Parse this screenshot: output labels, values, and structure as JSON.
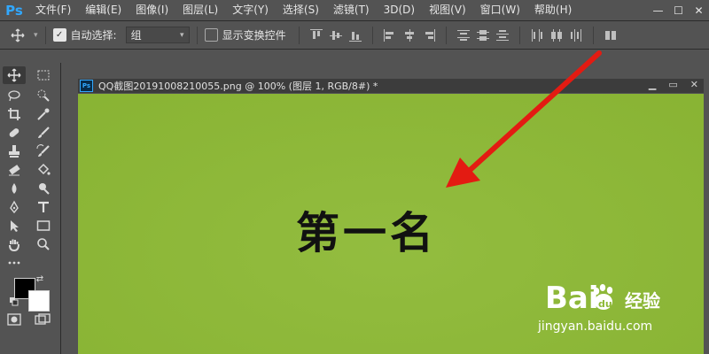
{
  "app": {
    "logo": "Ps"
  },
  "menu": {
    "items": [
      "文件(F)",
      "编辑(E)",
      "图像(I)",
      "图层(L)",
      "文字(Y)",
      "选择(S)",
      "滤镜(T)",
      "3D(D)",
      "视图(V)",
      "窗口(W)",
      "帮助(H)"
    ]
  },
  "window_controls": [
    "—",
    "☐",
    "✕"
  ],
  "options": {
    "auto_select_label": "自动选择:",
    "auto_select_checked": true,
    "group_value": "组",
    "transform_label": "显示变换控件",
    "transform_checked": false
  },
  "document": {
    "title": "QQ截图20191008210055.png @ 100% (图层 1, RGB/8#) *",
    "canvas_text": "第一名",
    "canvas_color": "#8db935",
    "arrow_color": "#e31b12"
  },
  "watermark": {
    "brand": "Bai",
    "product": "经验",
    "url": "jingyan.baidu.com"
  },
  "colors": {
    "foreground": "#000000",
    "background": "#ffffff"
  }
}
